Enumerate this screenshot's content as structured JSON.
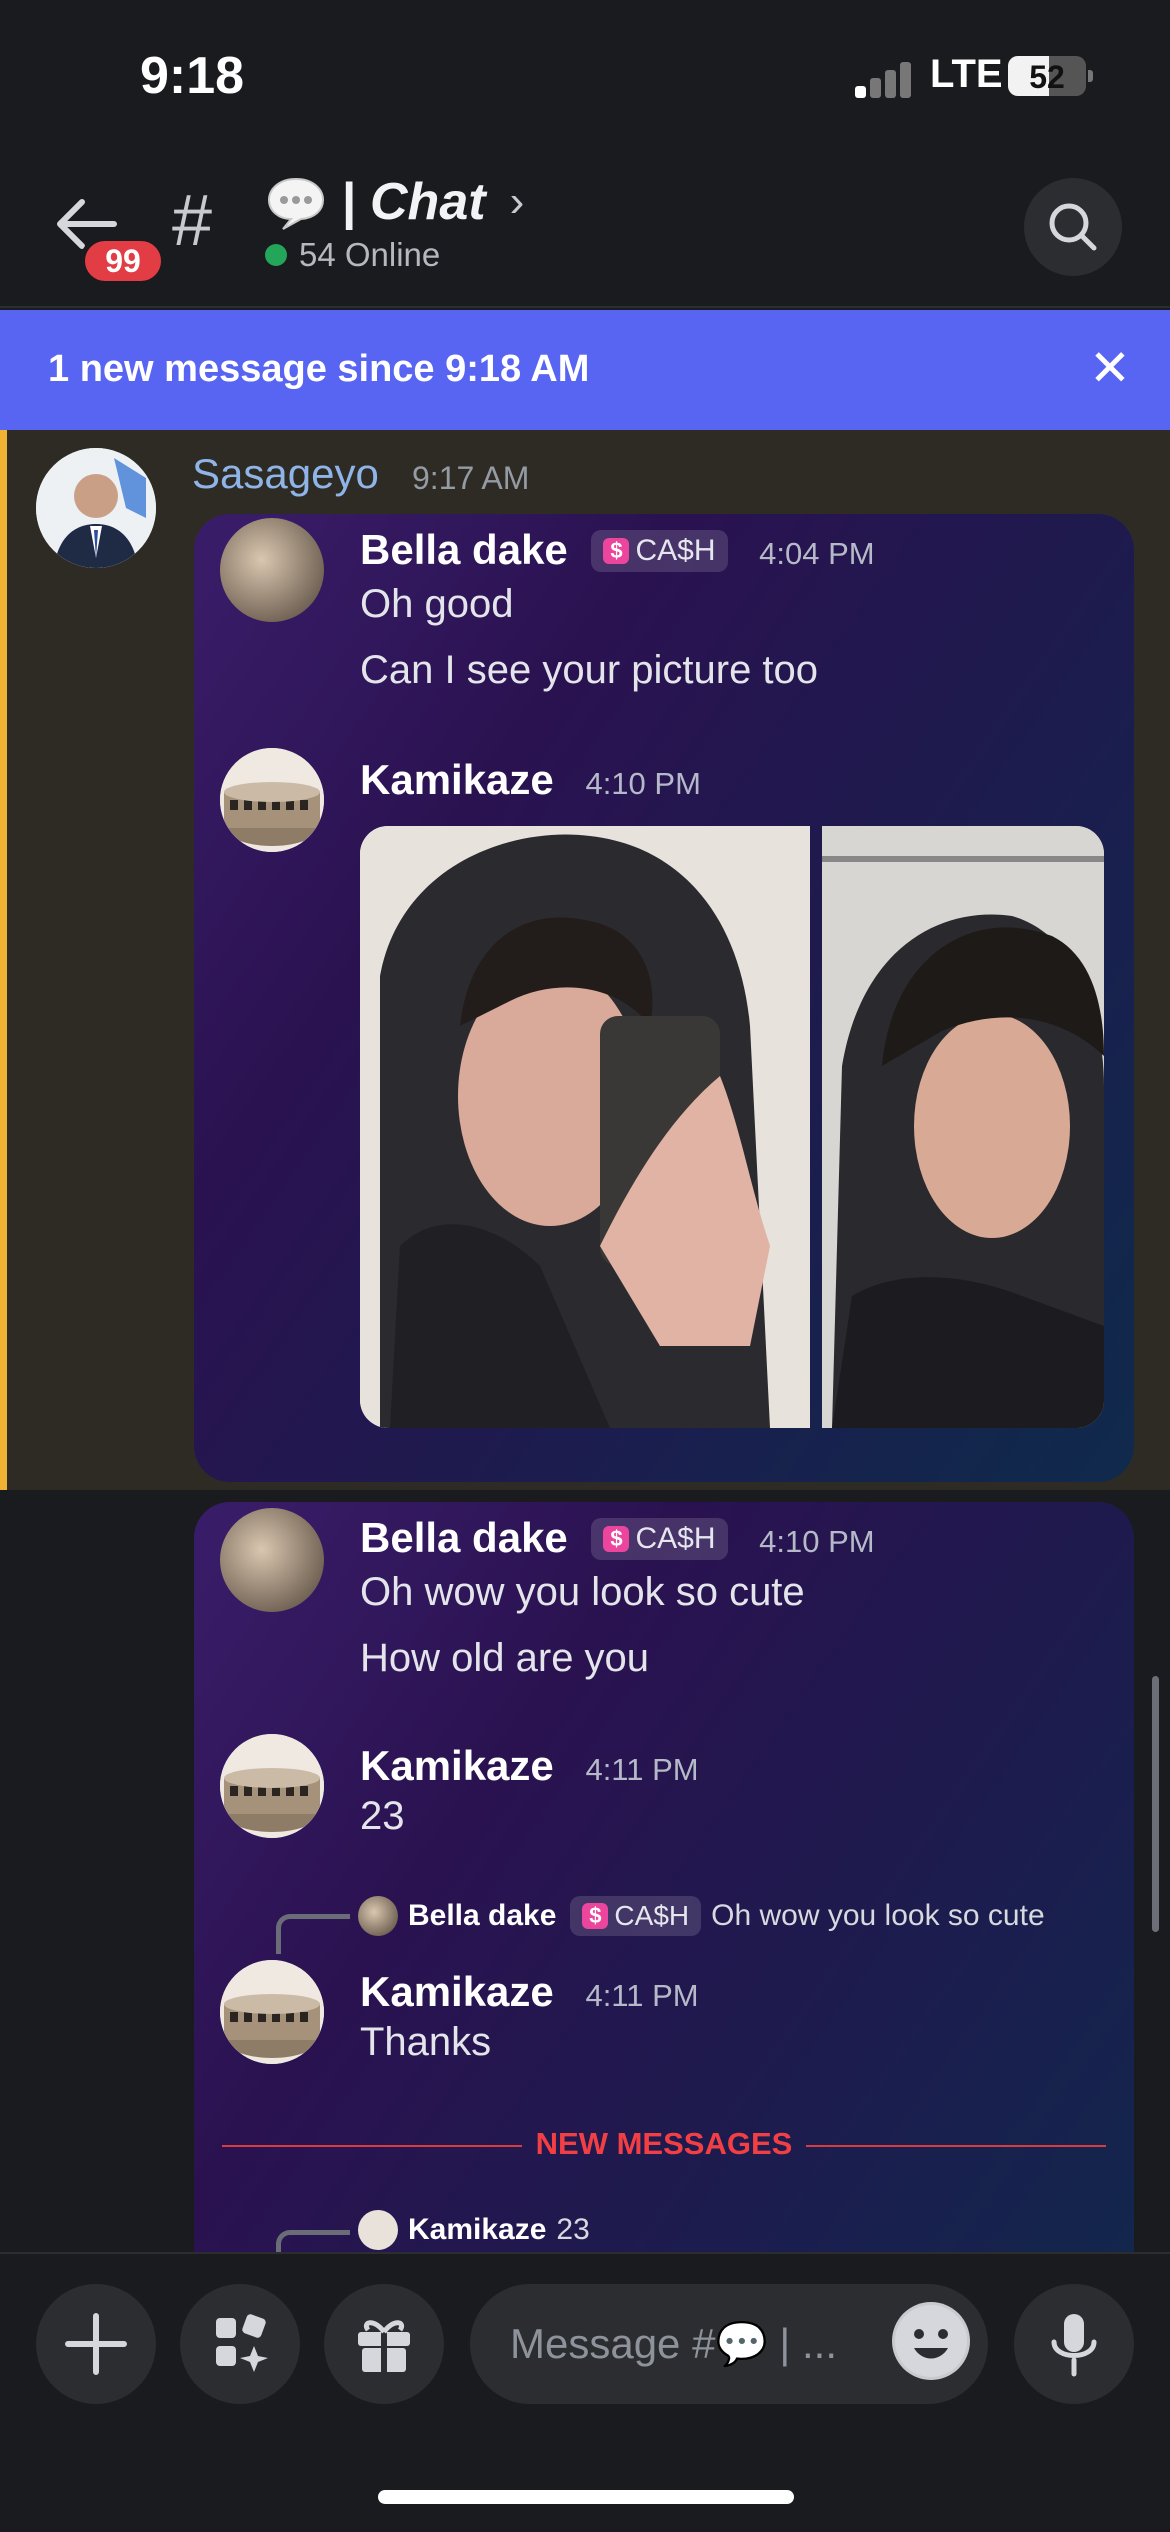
{
  "status": {
    "time": "9:18",
    "network": "LTE",
    "battery": "52",
    "battery_level": 0.52
  },
  "header": {
    "unread_badge": "99",
    "hash": "#",
    "channel_name": "| Chat",
    "chevron": "›",
    "online": "54 Online"
  },
  "banner": {
    "text": "1 new message since 9:18 AM",
    "close": "✕"
  },
  "post": {
    "author": "Sasageyo",
    "time": "9:17 AM"
  },
  "card1": {
    "m1": {
      "author": "Bella dake",
      "tag": "CA$H",
      "time": "4:04 PM",
      "lines": [
        "Oh good",
        "Can I see your picture too"
      ]
    },
    "m2": {
      "author": "Kamikaze",
      "time": "4:10 PM"
    }
  },
  "card2": {
    "m1": {
      "author": "Bella dake",
      "tag": "CA$H",
      "time": "4:10 PM",
      "lines": [
        "Oh wow you look so cute",
        "How old are you"
      ]
    },
    "m2": {
      "author": "Kamikaze",
      "time": "4:11 PM",
      "text": "23"
    },
    "reply1": {
      "author": "Bella dake",
      "tag": "CA$H",
      "text": "Oh wow you look so cute"
    },
    "m3": {
      "author": "Kamikaze",
      "time": "4:11 PM",
      "text": "Thanks"
    },
    "divider": "NEW MESSAGES",
    "reply2": {
      "author": "Kamikaze",
      "text": "23"
    }
  },
  "composer": {
    "placeholder": "Message #💬 | ..."
  },
  "colors": {
    "accent": "#5865f2",
    "highlight_bar": "#f0b232",
    "badge": "#e23c44",
    "new_messages": "#f23f43",
    "online": "#23a55a"
  }
}
